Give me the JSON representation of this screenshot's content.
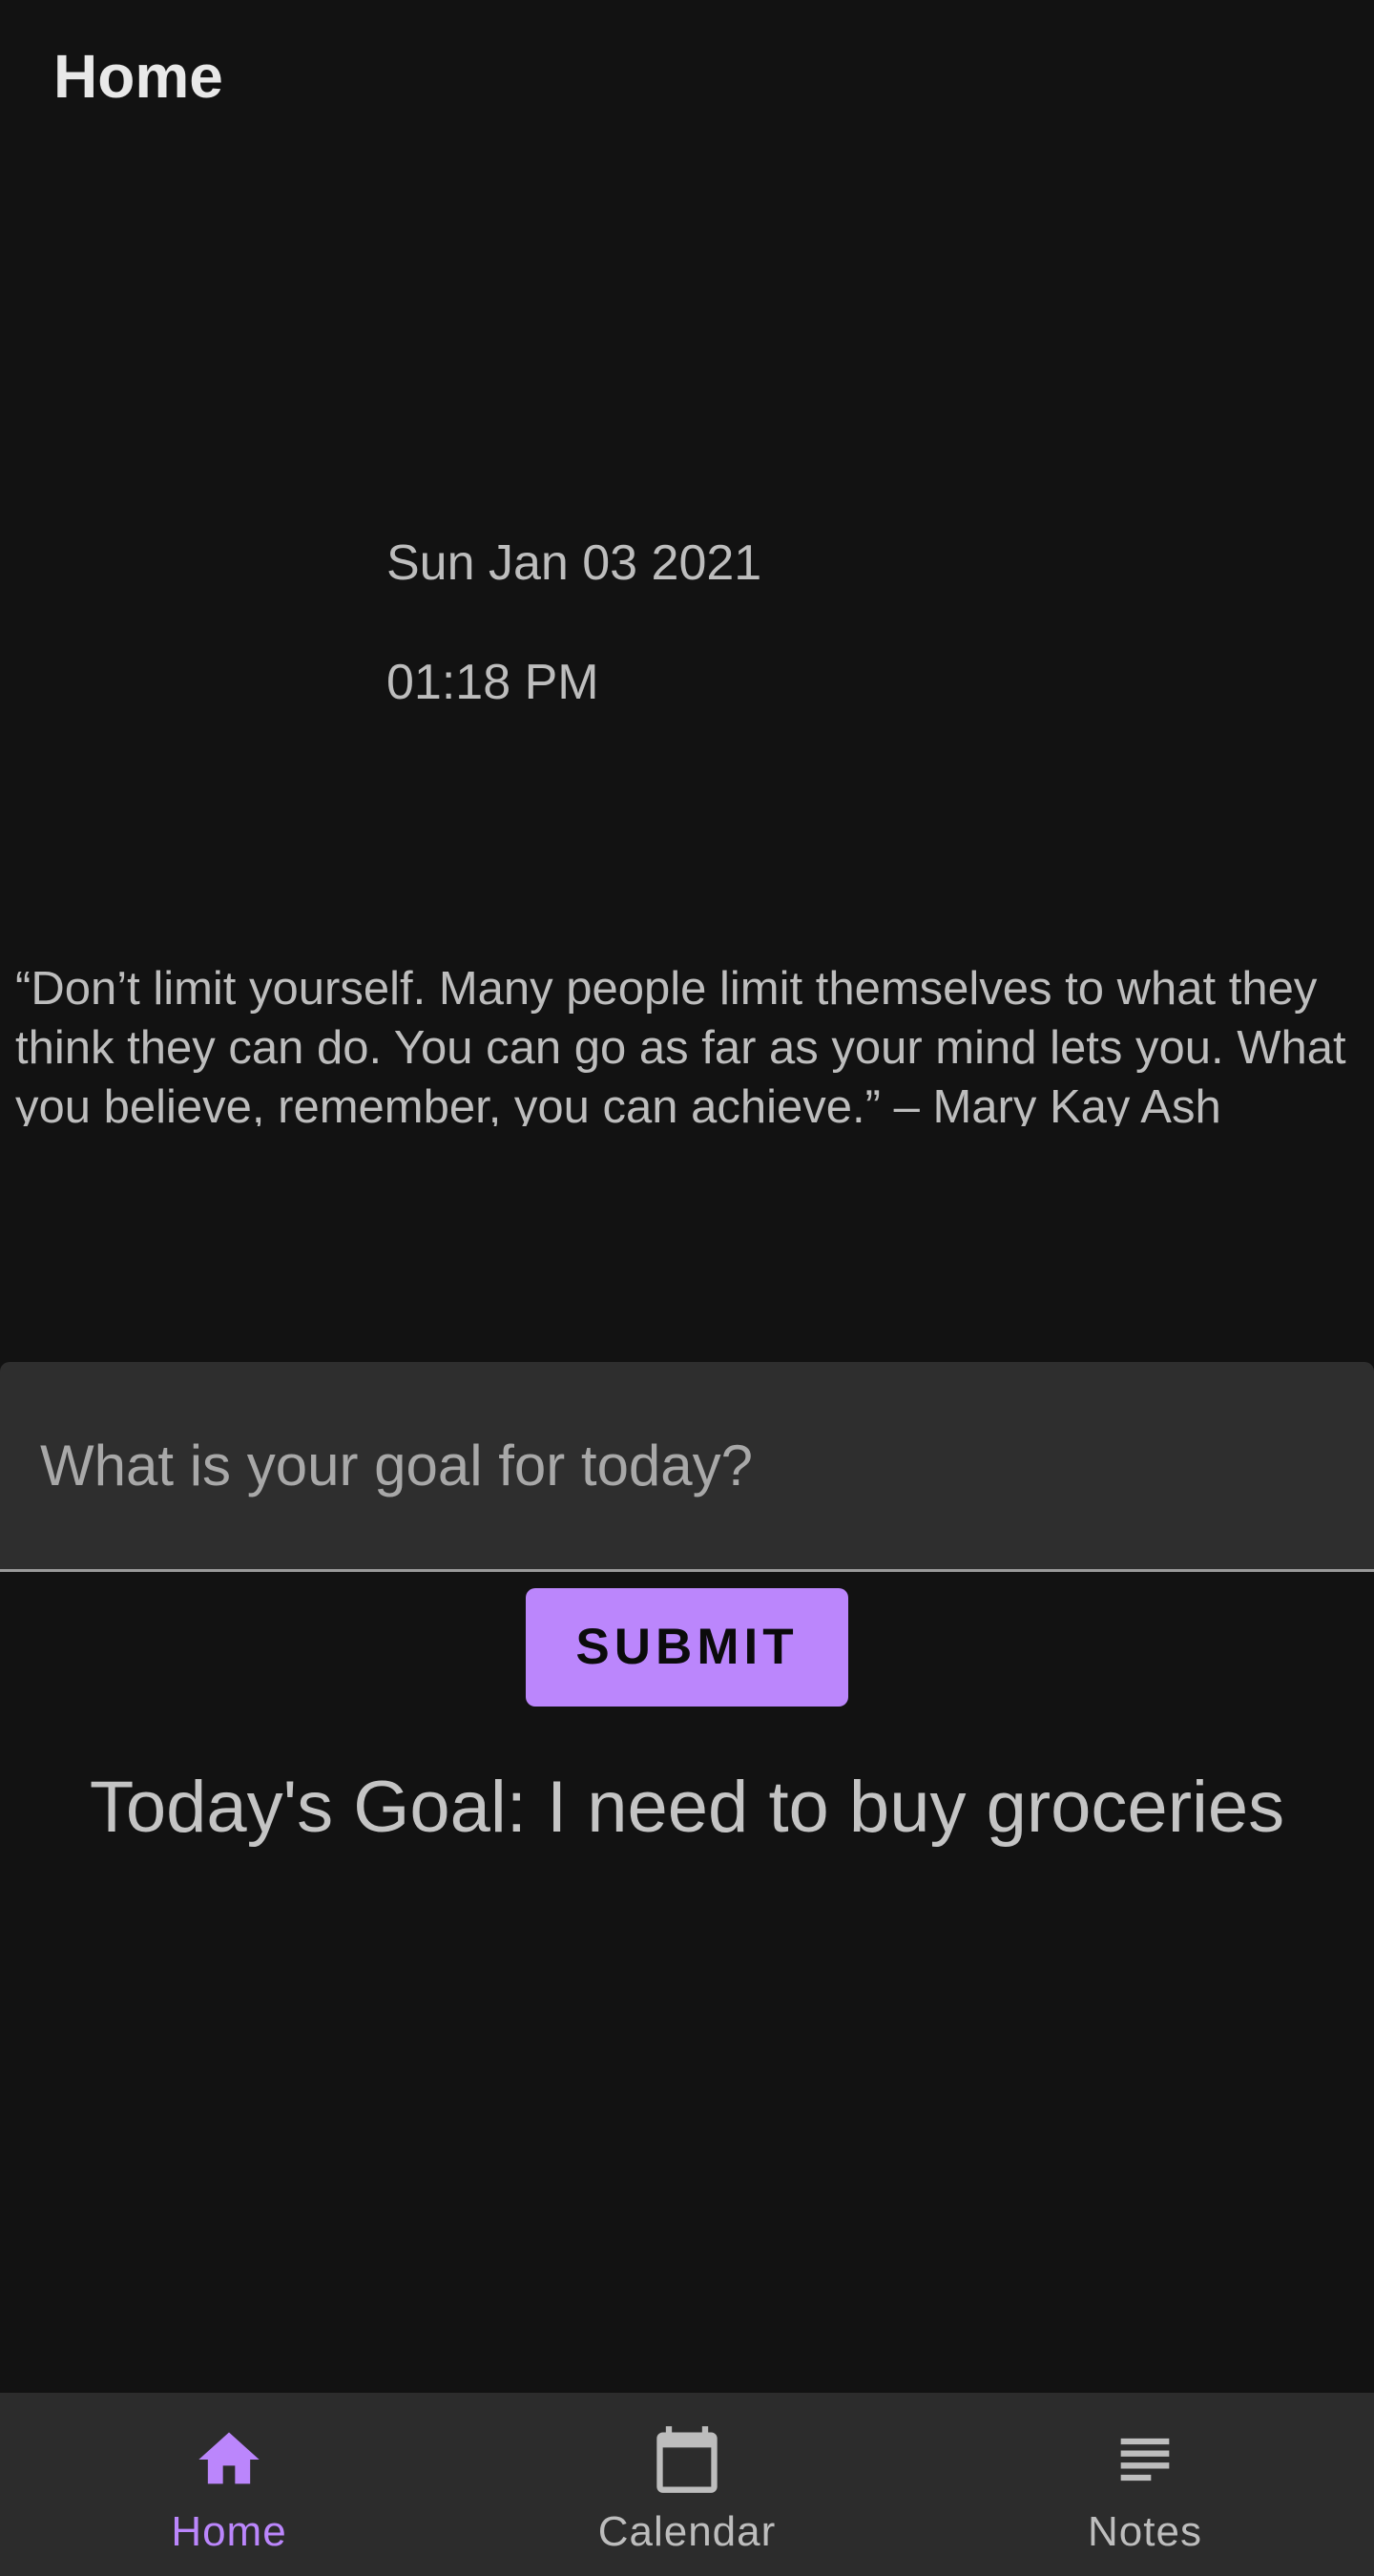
{
  "header": {
    "title": "Home"
  },
  "datetime": {
    "date": "Sun Jan 03 2021",
    "time": "01:18 PM"
  },
  "quote": {
    "text": "“Don’t limit yourself. Many people limit themselves to what they think they can do. You can go as far as your mind lets you. What you believe, remember, you can achieve.” – Mary Kay Ash"
  },
  "goal_form": {
    "placeholder": "What is your goal for today?",
    "value": "",
    "submit_label": "SUBMIT"
  },
  "todays_goal": {
    "text": "Today's Goal: I need to buy groceries"
  },
  "bottom_nav": {
    "items": [
      {
        "label": "Home",
        "icon": "home-icon",
        "active": true
      },
      {
        "label": "Calendar",
        "icon": "calendar-icon",
        "active": false
      },
      {
        "label": "Notes",
        "icon": "notes-icon",
        "active": false
      }
    ]
  },
  "colors": {
    "background": "#121212",
    "surface": "#2c2c2c",
    "accent": "#bb86fc",
    "inactive": "#bdbdbd"
  }
}
